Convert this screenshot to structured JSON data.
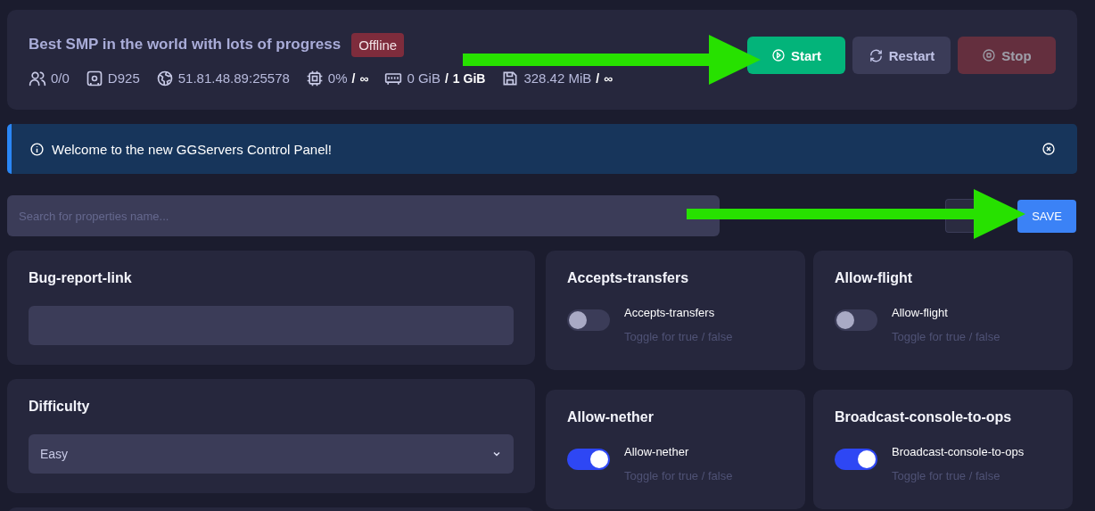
{
  "server": {
    "title": "Best SMP in the world with lots of progress",
    "status": "Offline",
    "stats": [
      {
        "kind": "players",
        "value": "0/0"
      },
      {
        "kind": "node",
        "value": "D925"
      },
      {
        "kind": "address",
        "value": "51.81.48.89:25578"
      },
      {
        "kind": "cpu",
        "value": "0%",
        "separator": "/",
        "limit": "∞"
      },
      {
        "kind": "memory",
        "value": "0 GiB",
        "separator": "/",
        "limit": "1 GiB"
      },
      {
        "kind": "disk",
        "value": "328.42 MiB",
        "separator": "/",
        "limit": "∞"
      }
    ],
    "buttons": [
      {
        "kind": "start",
        "label": "Start",
        "disabled": false
      },
      {
        "kind": "restart",
        "label": "Restart",
        "disabled": false
      },
      {
        "kind": "stop",
        "label": "Stop",
        "disabled": true
      }
    ]
  },
  "notice": {
    "text": "Welcome to the new GGServers Control Panel!"
  },
  "search": {
    "placeholder": "Search for properties name..."
  },
  "save_button": "SAVE",
  "properties_left": [
    {
      "kind": "text",
      "name": "Bug-report-link"
    },
    {
      "kind": "select",
      "name": "Difficulty",
      "value": "Easy"
    }
  ],
  "properties_right": [
    {
      "kind": "toggle",
      "name": "Accepts-transfers",
      "label": "Accepts-transfers",
      "hint": "Toggle for true / false",
      "on": false
    },
    {
      "kind": "toggle",
      "name": "Allow-flight",
      "label": "Allow-flight",
      "hint": "Toggle for true / false",
      "on": false
    },
    {
      "kind": "toggle",
      "name": "Allow-nether",
      "label": "Allow-nether",
      "hint": "Toggle for true / false",
      "on": true
    },
    {
      "kind": "toggle",
      "name": "Broadcast-console-to-ops",
      "label": "Broadcast-console-to-ops",
      "hint": "Toggle for true / false",
      "on": true
    }
  ]
}
